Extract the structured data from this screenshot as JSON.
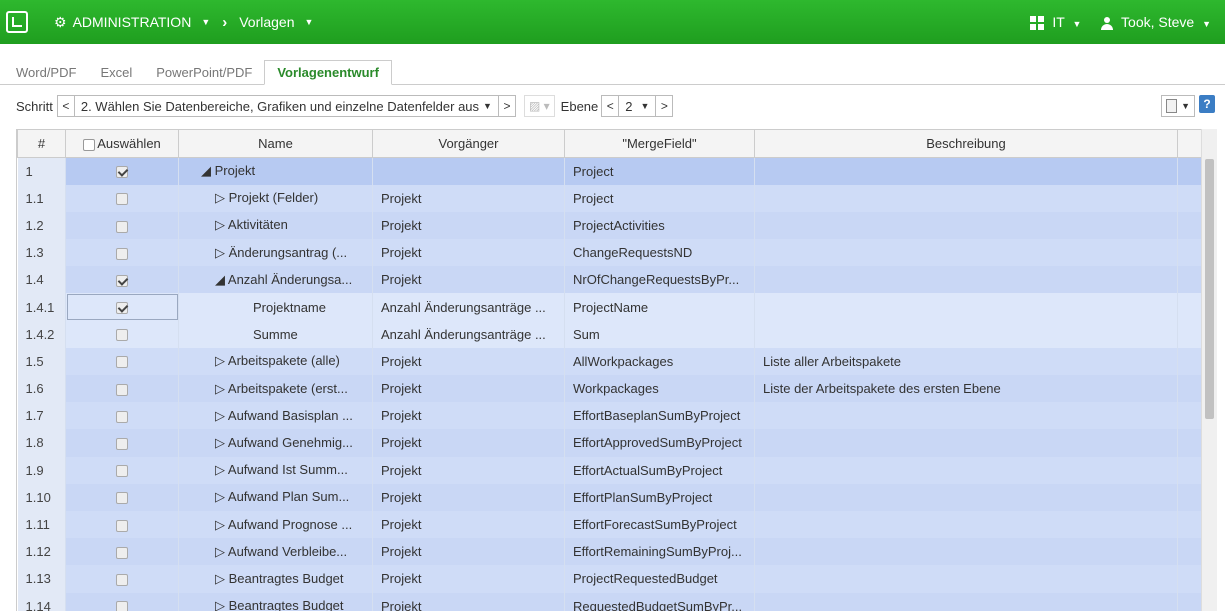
{
  "topbar": {
    "module": "ADMINISTRATION",
    "section": "Vorlagen",
    "org": "IT",
    "user": "Took, Steve"
  },
  "tabs": [
    {
      "label": "Word/PDF",
      "active": false
    },
    {
      "label": "Excel",
      "active": false
    },
    {
      "label": "PowerPoint/PDF",
      "active": false
    },
    {
      "label": "Vorlagenentwurf",
      "active": true
    }
  ],
  "toolbar": {
    "step_label": "Schritt",
    "step_value": "2. Wählen Sie Datenbereiche, Grafiken und einzelne Datenfelder aus",
    "level_label": "Ebene",
    "level_value": "2"
  },
  "table": {
    "headers": [
      "#",
      "Auswählen",
      "Name",
      "Vorgänger",
      "\"MergeField\"",
      "Beschreibung"
    ],
    "rows": [
      {
        "num": "1",
        "checked": true,
        "name": "◢ Projekt",
        "prev": "",
        "field": "Project",
        "desc": "",
        "indent": 0
      },
      {
        "num": "1.1",
        "checked": false,
        "name": "▷ Projekt (Felder)",
        "prev": "Projekt",
        "field": "Project",
        "desc": "",
        "indent": 1
      },
      {
        "num": "1.2",
        "checked": false,
        "name": "▷ Aktivitäten",
        "prev": "Projekt",
        "field": "ProjectActivities",
        "desc": "",
        "indent": 1
      },
      {
        "num": "1.3",
        "checked": false,
        "name": "▷ Änderungsantrag (...",
        "prev": "Projekt",
        "field": "ChangeRequestsND",
        "desc": "",
        "indent": 1
      },
      {
        "num": "1.4",
        "checked": true,
        "name": "◢ Anzahl Änderungsa...",
        "prev": "Projekt",
        "field": "NrOfChangeRequestsByPr...",
        "desc": "",
        "indent": 1
      },
      {
        "num": "1.4.1",
        "checked": true,
        "name": "Projektname",
        "prev": "Anzahl Änderungsanträge ...",
        "field": "ProjectName",
        "desc": "",
        "indent": 2
      },
      {
        "num": "1.4.2",
        "checked": false,
        "name": "Summe",
        "prev": "Anzahl Änderungsanträge ...",
        "field": "Sum",
        "desc": "",
        "indent": 2
      },
      {
        "num": "1.5",
        "checked": false,
        "name": "▷ Arbeitspakete (alle)",
        "prev": "Projekt",
        "field": "AllWorkpackages",
        "desc": "Liste aller Arbeitspakete",
        "indent": 1
      },
      {
        "num": "1.6",
        "checked": false,
        "name": "▷ Arbeitspakete (erst...",
        "prev": "Projekt",
        "field": "Workpackages",
        "desc": "Liste der Arbeitspakete des ersten Ebene",
        "indent": 1
      },
      {
        "num": "1.7",
        "checked": false,
        "name": "▷ Aufwand Basisplan ...",
        "prev": "Projekt",
        "field": "EffortBaseplanSumByProject",
        "desc": "",
        "indent": 1
      },
      {
        "num": "1.8",
        "checked": false,
        "name": "▷ Aufwand Genehmig...",
        "prev": "Projekt",
        "field": "EffortApprovedSumByProject",
        "desc": "",
        "indent": 1
      },
      {
        "num": "1.9",
        "checked": false,
        "name": "▷ Aufwand Ist Summ...",
        "prev": "Projekt",
        "field": "EffortActualSumByProject",
        "desc": "",
        "indent": 1
      },
      {
        "num": "1.10",
        "checked": false,
        "name": "▷ Aufwand Plan Sum...",
        "prev": "Projekt",
        "field": "EffortPlanSumByProject",
        "desc": "",
        "indent": 1
      },
      {
        "num": "1.11",
        "checked": false,
        "name": "▷ Aufwand Prognose ...",
        "prev": "Projekt",
        "field": "EffortForecastSumByProject",
        "desc": "",
        "indent": 1
      },
      {
        "num": "1.12",
        "checked": false,
        "name": "▷ Aufwand Verbleibe...",
        "prev": "Projekt",
        "field": "EffortRemainingSumByProj...",
        "desc": "",
        "indent": 1
      },
      {
        "num": "1.13",
        "checked": false,
        "name": "▷ Beantragtes Budget",
        "prev": "Projekt",
        "field": "ProjectRequestedBudget",
        "desc": "",
        "indent": 1
      },
      {
        "num": "1.14",
        "checked": false,
        "name": "▷ Beantragtes Budget",
        "prev": "Projekt",
        "field": "RequestedBudgetSumByPr...",
        "desc": "",
        "indent": 1
      }
    ]
  },
  "colors": {
    "topbar": "#22a822",
    "accent": "#2a8a2a",
    "row": "#cfdcf7",
    "row_selected": "#b7caf2"
  }
}
